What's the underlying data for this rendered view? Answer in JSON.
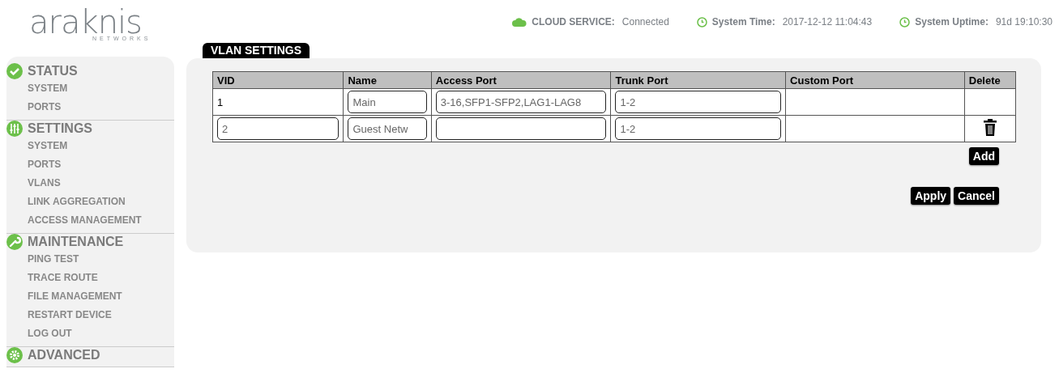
{
  "logo": {
    "name": "araknis",
    "tagline": "NETWORKS"
  },
  "status_bar": [
    {
      "kind": "cloud",
      "label": "CLOUD SERVICE:",
      "value": "Connected"
    },
    {
      "kind": "clock",
      "label": "System Time:",
      "value": "2017-12-12 11:04:43"
    },
    {
      "kind": "clock",
      "label": "System Uptime:",
      "value": "91d 19:10:30"
    }
  ],
  "sidebar": [
    {
      "kind": "check",
      "title": "STATUS",
      "items": [
        "SYSTEM",
        "PORTS"
      ]
    },
    {
      "kind": "sliders",
      "title": "SETTINGS",
      "items": [
        "SYSTEM",
        "PORTS",
        "VLANS",
        "LINK AGGREGATION",
        "ACCESS MANAGEMENT"
      ]
    },
    {
      "kind": "wrench",
      "title": "MAINTENANCE",
      "items": [
        "PING TEST",
        "TRACE ROUTE",
        "FILE MANAGEMENT",
        "RESTART DEVICE",
        "LOG OUT"
      ]
    },
    {
      "kind": "gear",
      "title": "ADVANCED"
    }
  ],
  "panel": {
    "tab": "VLAN SETTINGS",
    "table": {
      "columns": [
        "VID",
        "Name",
        "Access Port",
        "Trunk Port",
        "Custom Port",
        "Delete"
      ],
      "rows": [
        [
          {
            "kind": "text",
            "value": "1"
          },
          {
            "kind": "input",
            "value": "Main"
          },
          {
            "kind": "input",
            "value": "3-16,SFP1-SFP2,LAG1-LAG8"
          },
          {
            "kind": "input",
            "value": "1-2"
          },
          {
            "kind": "empty"
          },
          {
            "kind": "empty"
          }
        ],
        [
          {
            "kind": "input",
            "value": "2"
          },
          {
            "kind": "input",
            "value": "Guest Netw"
          },
          {
            "kind": "input"
          },
          {
            "kind": "input",
            "value": "1-2"
          },
          {
            "kind": "empty"
          },
          {
            "kind": "delete"
          }
        ]
      ]
    },
    "add_button": "Add",
    "buttons": [
      "Apply",
      "Cancel"
    ]
  }
}
